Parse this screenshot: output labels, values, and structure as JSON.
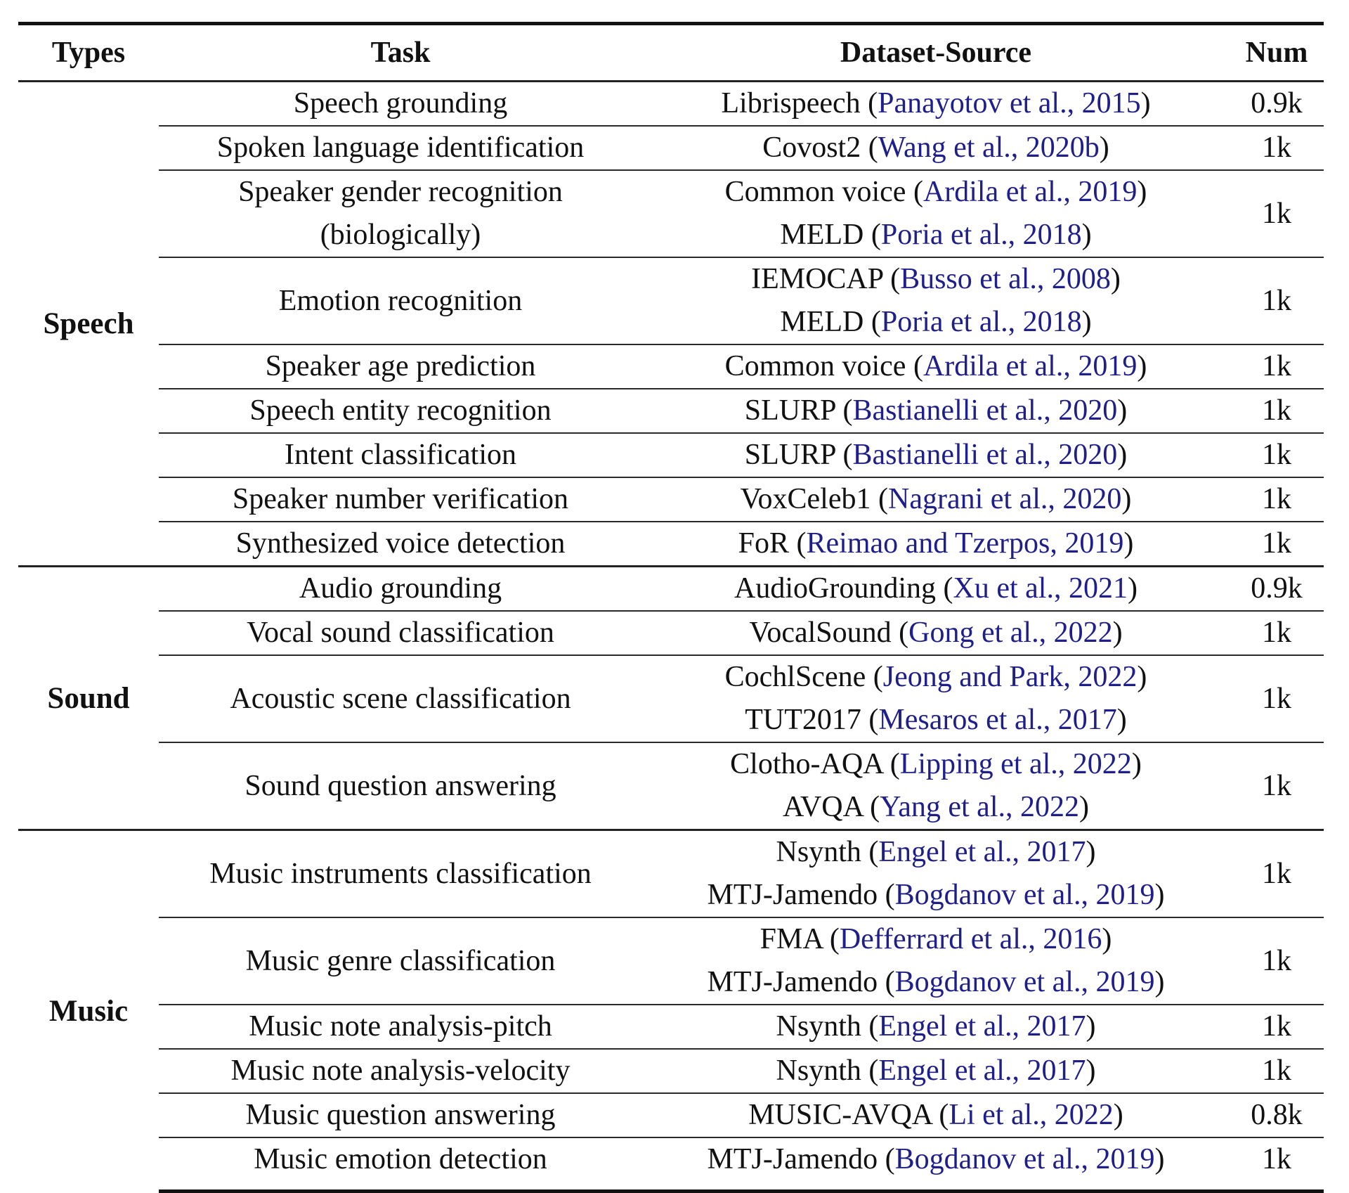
{
  "table": {
    "headers": {
      "types": "Types",
      "task": "Task",
      "dataset": "Dataset-Source",
      "num": "Num"
    },
    "colors": {
      "citation": "#1f1f8a",
      "text": "#111111"
    },
    "sections": [
      {
        "type": "Speech",
        "rows": [
          {
            "task": [
              "Speech grounding"
            ],
            "sources": [
              {
                "name": "Librispeech",
                "cite": "Panayotov et al., 2015"
              }
            ],
            "num": "0.9k"
          },
          {
            "task": [
              "Spoken language identification"
            ],
            "sources": [
              {
                "name": "Covost2",
                "cite": "Wang et al., 2020b"
              }
            ],
            "num": "1k"
          },
          {
            "task": [
              "Speaker gender recognition",
              "(biologically)"
            ],
            "sources": [
              {
                "name": "Common voice",
                "cite": "Ardila et al., 2019"
              },
              {
                "name": "MELD",
                "cite": "Poria et al., 2018"
              }
            ],
            "num": "1k"
          },
          {
            "task": [
              "Emotion recognition"
            ],
            "sources": [
              {
                "name": "IEMOCAP",
                "cite": "Busso et al., 2008"
              },
              {
                "name": "MELD",
                "cite": "Poria et al., 2018"
              }
            ],
            "num": "1k"
          },
          {
            "task": [
              "Speaker age prediction"
            ],
            "sources": [
              {
                "name": "Common voice",
                "cite": "Ardila et al., 2019"
              }
            ],
            "num": "1k"
          },
          {
            "task": [
              "Speech entity recognition"
            ],
            "sources": [
              {
                "name": "SLURP",
                "cite": "Bastianelli et al., 2020"
              }
            ],
            "num": "1k"
          },
          {
            "task": [
              "Intent classification"
            ],
            "sources": [
              {
                "name": "SLURP",
                "cite": "Bastianelli et al., 2020"
              }
            ],
            "num": "1k"
          },
          {
            "task": [
              "Speaker number verification"
            ],
            "sources": [
              {
                "name": "VoxCeleb1",
                "cite": "Nagrani et al., 2020"
              }
            ],
            "num": "1k"
          },
          {
            "task": [
              "Synthesized voice detection"
            ],
            "sources": [
              {
                "name": "FoR",
                "cite": "Reimao and Tzerpos, 2019"
              }
            ],
            "num": "1k"
          }
        ]
      },
      {
        "type": "Sound",
        "rows": [
          {
            "task": [
              "Audio grounding"
            ],
            "sources": [
              {
                "name": "AudioGrounding",
                "cite": "Xu et al., 2021"
              }
            ],
            "num": "0.9k"
          },
          {
            "task": [
              "Vocal sound classification"
            ],
            "sources": [
              {
                "name": "VocalSound",
                "cite": "Gong et al., 2022"
              }
            ],
            "num": "1k"
          },
          {
            "task": [
              "Acoustic scene classification"
            ],
            "sources": [
              {
                "name": "CochlScene",
                "cite": "Jeong and Park, 2022"
              },
              {
                "name": "TUT2017",
                "cite": "Mesaros et al., 2017"
              }
            ],
            "num": "1k"
          },
          {
            "task": [
              "Sound question answering"
            ],
            "sources": [
              {
                "name": "Clotho-AQA",
                "cite": "Lipping et al., 2022"
              },
              {
                "name": "AVQA",
                "cite": "Yang et al., 2022"
              }
            ],
            "num": "1k"
          }
        ]
      },
      {
        "type": "Music",
        "rows": [
          {
            "task": [
              "Music instruments classification"
            ],
            "sources": [
              {
                "name": "Nsynth",
                "cite": "Engel et al., 2017"
              },
              {
                "name": "MTJ-Jamendo",
                "cite": "Bogdanov et al., 2019"
              }
            ],
            "num": "1k"
          },
          {
            "task": [
              "Music genre classification"
            ],
            "sources": [
              {
                "name": "FMA",
                "cite": "Defferrard et al., 2016"
              },
              {
                "name": "MTJ-Jamendo",
                "cite": "Bogdanov et al., 2019"
              }
            ],
            "num": "1k"
          },
          {
            "task": [
              "Music note analysis-pitch"
            ],
            "sources": [
              {
                "name": "Nsynth",
                "cite": "Engel et al., 2017"
              }
            ],
            "num": "1k"
          },
          {
            "task": [
              "Music note analysis-velocity"
            ],
            "sources": [
              {
                "name": "Nsynth",
                "cite": "Engel et al., 2017"
              }
            ],
            "num": "1k"
          },
          {
            "task": [
              "Music question answering"
            ],
            "sources": [
              {
                "name": "MUSIC-AVQA",
                "cite": "Li et al., 2022"
              }
            ],
            "num": "0.8k"
          },
          {
            "task": [
              "Music emotion detection"
            ],
            "sources": [
              {
                "name": "MTJ-Jamendo",
                "cite": "Bogdanov et al., 2019"
              }
            ],
            "num": "1k"
          }
        ]
      }
    ]
  }
}
